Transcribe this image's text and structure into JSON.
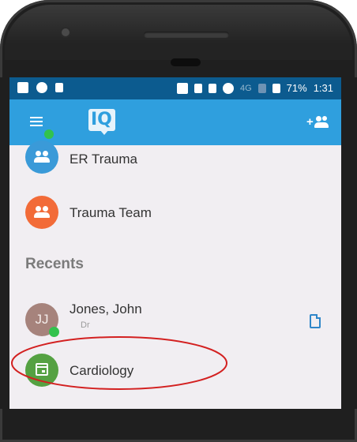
{
  "status_bar": {
    "battery": "71%",
    "time": "1:31",
    "network": "4G"
  },
  "app_bar": {
    "menu_icon": "hamburger-menu-icon",
    "logo_text": "IQ",
    "add_contact_icon": "add-people-icon"
  },
  "groups": [
    {
      "label": "ER Trauma",
      "color": "#3a9ad8",
      "icon": "group-icon"
    },
    {
      "label": "Trauma Team",
      "color": "#f26b38",
      "icon": "group-icon"
    }
  ],
  "recents": {
    "title": "Recents",
    "items": [
      {
        "name": "Jones, John",
        "subtitle": "Dr",
        "initials": "JJ",
        "avatar_color": "#a6837c",
        "status_color": "#32c24d",
        "icon": "document-icon"
      },
      {
        "name": "Cardiology",
        "avatar_color": "#55a142",
        "icon": "calendar-icon"
      }
    ]
  },
  "highlight_color": "#d32020",
  "colors": {
    "app_bar": "#2f9fde",
    "status_bar": "#0c5b8f",
    "background": "#f1eef2",
    "online": "#32c24d"
  }
}
